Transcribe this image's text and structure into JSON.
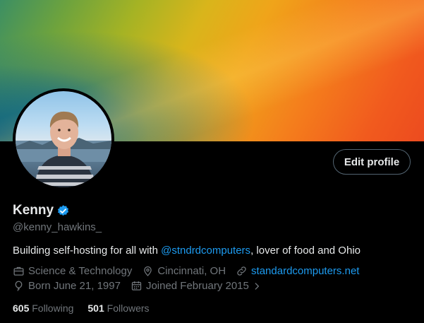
{
  "colors": {
    "accent": "#1d9bf0",
    "muted": "#71767b",
    "text": "#e7e9ea",
    "background": "#000000"
  },
  "profile": {
    "edit_label": "Edit profile",
    "name": "Kenny",
    "handle": "@kenny_hawkins_",
    "bio": {
      "prefix": "Building self-hosting for all with ",
      "mention": "@stndrdcomputers",
      "suffix": ", lover of food and Ohio"
    },
    "meta": {
      "category": "Science & Technology",
      "location": "Cincinnati, OH",
      "website": "standardcomputers.net",
      "birthday": "Born June 21, 1997",
      "joined": "Joined February 2015"
    },
    "following_count": "605",
    "following_label": "Following",
    "followers_count": "501",
    "followers_label": "Followers"
  },
  "icons": {
    "verified": "verified-badge-icon",
    "category": "briefcase-icon",
    "location": "location-pin-icon",
    "website": "link-icon",
    "birthday": "balloon-icon",
    "joined": "calendar-icon",
    "joined_more": "chevron-right-icon"
  }
}
